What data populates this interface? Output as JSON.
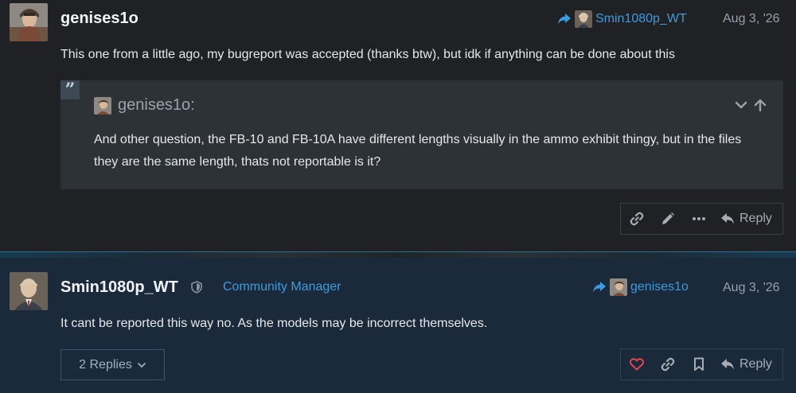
{
  "post1": {
    "username": "genises1o",
    "reply_to_user": "Smin1080p_WT",
    "date": "Aug 3, '26",
    "text": "This one from a little ago, my bugreport was accepted (thanks btw), but idk if anything can be done about this",
    "quote": {
      "author": "genises1o:",
      "text": "And other question, the FB-10 and FB-10A have different lengths visually in the ammo exhibit thingy, but in the files they are the same length, thats not reportable is it?"
    },
    "actions": {
      "reply_label": "Reply"
    }
  },
  "post2": {
    "username": "Smin1080p_WT",
    "role": "Community Manager",
    "reply_to_user": "genises1o",
    "date": "Aug 3, '26",
    "text": "It cant be reported this way no. As the models may be incorrect themselves.",
    "replies_label": "2 Replies",
    "actions": {
      "reply_label": "Reply"
    }
  },
  "colors": {
    "accent": "#3b9bdc",
    "like": "#e0444f",
    "bg_post": "#1f2124",
    "bg_highlight": "#1a2a3a",
    "quote_bg": "#2d3237"
  }
}
